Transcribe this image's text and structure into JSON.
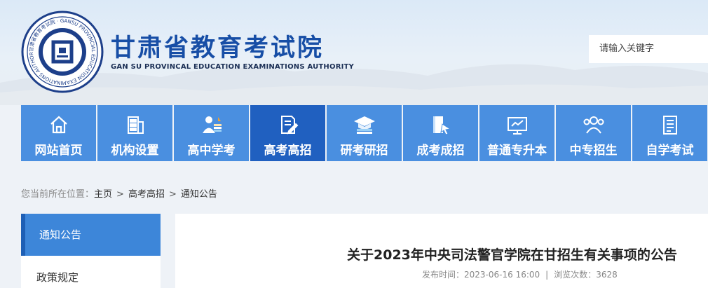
{
  "header": {
    "title": "甘肃省教育考试院",
    "subtitle": "GAN SU PROVINCAL EDUCATION EXAMINATIONS AUTHORITY",
    "logo_ring_text": "甘肃省教育考试院 · GANSU PROVINCIAL EDUCATION EXAMINATIONS AUTHORITY"
  },
  "search": {
    "placeholder": "请输入关键字"
  },
  "nav": {
    "items": [
      {
        "label": "网站首页",
        "icon": "home-icon"
      },
      {
        "label": "机构设置",
        "icon": "building-icon"
      },
      {
        "label": "高中学考",
        "icon": "student-icon"
      },
      {
        "label": "高考高招",
        "icon": "document-pen-icon",
        "active": true
      },
      {
        "label": "研考研招",
        "icon": "graduation-cap-icon"
      },
      {
        "label": "成考成招",
        "icon": "book-pointer-icon"
      },
      {
        "label": "普通专升本",
        "icon": "presentation-board-icon"
      },
      {
        "label": "中专招生",
        "icon": "users-icon"
      },
      {
        "label": "自学考试",
        "icon": "clipboard-list-icon"
      }
    ]
  },
  "breadcrumb": {
    "prefix": "您当前所在位置：",
    "items": [
      "主页",
      "高考高招",
      "通知公告"
    ],
    "separator": ">"
  },
  "sidebar": {
    "items": [
      {
        "label": "通知公告",
        "active": true
      },
      {
        "label": "政策规定"
      }
    ]
  },
  "article": {
    "title": "关于2023年中央司法警官学院在甘招生有关事项的公告",
    "published_label": "发布时间：",
    "published": "2023-06-16 16:00",
    "views_label": "浏览次数：",
    "views": "3628"
  },
  "colors": {
    "nav": "#4a8fe0",
    "nav_active": "#2060c0",
    "brand": "#174ea6"
  }
}
